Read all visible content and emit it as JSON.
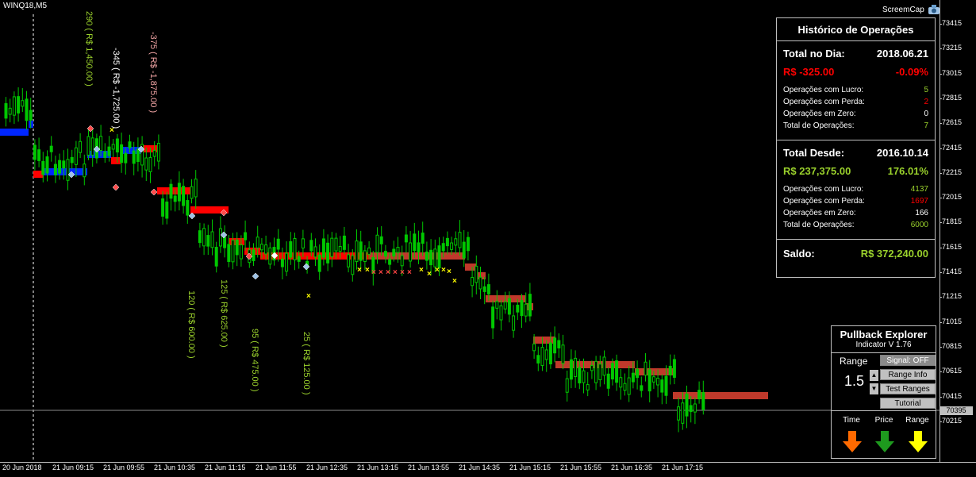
{
  "chart": {
    "symbol": "WINQ18,M5",
    "screencap_label": "ScreemCap",
    "price_ticks": [
      "73415",
      "73215",
      "73015",
      "72815",
      "72615",
      "72415",
      "72215",
      "72015",
      "71815",
      "71615",
      "71415",
      "71215",
      "71015",
      "70815",
      "70615",
      "70415",
      "70215"
    ],
    "current_price": "70395",
    "time_ticks": [
      "20 Jun 2018",
      "21 Jun 09:15",
      "21 Jun 09:55",
      "21 Jun 10:35",
      "21 Jun 11:15",
      "21 Jun 11:55",
      "21 Jun 12:35",
      "21 Jun 13:15",
      "21 Jun 13:55",
      "21 Jun 14:35",
      "21 Jun 15:15",
      "21 Jun 15:55",
      "21 Jun 16:35",
      "21 Jun 17:15"
    ],
    "trade_labels": [
      {
        "text": "290 ( R$ 1,450.00 )",
        "color": "#9ad12c"
      },
      {
        "text": "-345 ( R$ -1,725.00 )",
        "color": "#ffffff"
      },
      {
        "text": "-375 ( R$ -1,875.00 )",
        "color": "#f4a6a6"
      },
      {
        "text": "120 ( R$ 600.00 )",
        "color": "#9ad12c"
      },
      {
        "text": "125 ( R$ 625.00 )",
        "color": "#9ad12c"
      },
      {
        "text": "95 ( R$ 475.00 )",
        "color": "#9ad12c"
      },
      {
        "text": "25 ( R$ 125.00 )",
        "color": "#9ad12c"
      }
    ]
  },
  "historico": {
    "title": "Histórico de Operações",
    "day_label": "Total no Dia:",
    "day_date": "2018.06.21",
    "day_money": "R$ -325.00",
    "day_pct": "-0.09%",
    "day_stats": [
      {
        "label": "Operações com Lucro:",
        "value": "5"
      },
      {
        "label": "Operações com Perda:",
        "value": "2"
      },
      {
        "label": "Operações em Zero:",
        "value": "0"
      },
      {
        "label": "Total de Operações:",
        "value": "7"
      }
    ],
    "since_label": "Total Desde:",
    "since_date": "2016.10.14",
    "since_money": "R$ 237,375.00",
    "since_pct": "176.01%",
    "since_stats": [
      {
        "label": "Operações com Lucro:",
        "value": "4137"
      },
      {
        "label": "Operações com Perda:",
        "value": "1697"
      },
      {
        "label": "Operações em Zero:",
        "value": "166"
      },
      {
        "label": "Total de Operações:",
        "value": "6000"
      }
    ],
    "saldo_label": "Saldo:",
    "saldo_value": "R$ 372,240.00"
  },
  "pullback": {
    "title": "Pullback Explorer",
    "subtitle": "Indicator V 1.76",
    "range_label": "Range",
    "range_value": "1.5",
    "signal_button": "Signal: OFF",
    "range_info_button": "Range Info",
    "test_ranges_button": "Test Ranges",
    "tutorial_button": "Tutorial",
    "dir_labels": [
      "Time",
      "Price",
      "Range"
    ],
    "arrow_colors": [
      "#ff6a00",
      "#1e9a1e",
      "#ffff00"
    ]
  },
  "colors": {
    "bull": "#00c800",
    "bear": "#ff0000",
    "up": "#0026ff",
    "profit": "#9ad12c"
  }
}
